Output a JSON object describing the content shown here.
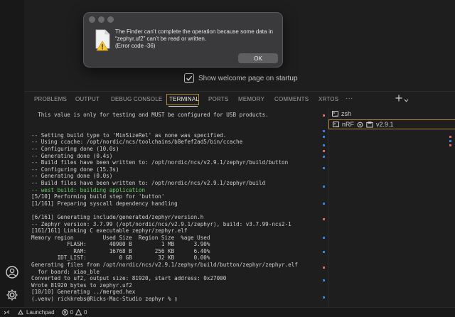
{
  "dialog": {
    "message": "The Finder can’t complete the operation because some data in “zephyr.uf2” can’t be read or written.",
    "error_code": "(Error code -36)",
    "ok_label": "OK"
  },
  "welcome": {
    "label": "Show welcome page on startup",
    "checked": true
  },
  "panel": {
    "tabs": [
      {
        "label": "PROBLEMS"
      },
      {
        "label": "OUTPUT"
      },
      {
        "label": "DEBUG CONSOLE"
      },
      {
        "label": "TERMINAL"
      },
      {
        "label": "PORTS"
      },
      {
        "label": "MEMORY"
      },
      {
        "label": "COMMENTS"
      },
      {
        "label": "XRTOS"
      }
    ],
    "more": "···",
    "active_tab": "TERMINAL"
  },
  "terminal": {
    "lines": [
      "  This value is only for testing and MUST be configured for USB products.",
      "",
      "",
      "-- Setting build type to 'MinSizeRel' as none was specified.",
      "-- Using ccache: /opt/nordic/ncs/toolchains/b8efef2ad5/bin/ccache",
      "-- Configuring done (10.0s)",
      "-- Generating done (0.4s)",
      "-- Build files have been written to: /opt/nordic/ncs/v2.9.1/zephyr/build/button",
      "-- Configuring done (15.3s)",
      "-- Generating done (0.0s)",
      "-- Build files have been written to: /opt/nordic/ncs/v2.9.1/zephyr/build",
      "-- west build: building application",
      "[5/10] Performing build step for 'button'",
      "[1/161] Preparing syscall dependency handling",
      "",
      "[6/161] Generating include/generated/zephyr/version.h",
      "-- Zephyr version: 3.7.99 (/opt/nordic/ncs/v2.9.1/zephyr), build: v3.7.99-ncs2-1",
      "[161/161] Linking C executable zephyr/zephyr.elf",
      "Memory region         Used Size  Region Size  %age Used",
      "           FLASH:       40900 B         1 MB      3.90%",
      "             RAM:       16768 B       256 KB      6.40%",
      "        IDT_LIST:          0 GB        32 KB      0.00%",
      "Generating files from /opt/nordic/ncs/v2.9.1/zephyr/build/button/zephyr/zephyr.elf",
      "  for board: xiao_ble",
      "Converted to uf2, output size: 81920, start address: 0x27000",
      "Wrote 81920 bytes to zephyr.uf2",
      "[10/10] Generating ../merged.hex",
      "(.venv) rickkrebs@Ricks-Mac-Studio zephyr % ▯"
    ],
    "highlight_line": 11
  },
  "terminals": [
    {
      "label": "zsh"
    },
    {
      "label": "nRF",
      "version": "v2.9.1"
    }
  ],
  "status": {
    "errors": "0",
    "warnings": "0",
    "launchpad": "Launchpad"
  },
  "colors": {
    "accent": "#b0873e",
    "green": "#5fd35f",
    "marker_blue": "#3c82d8",
    "marker_red": "#d86a6a"
  }
}
